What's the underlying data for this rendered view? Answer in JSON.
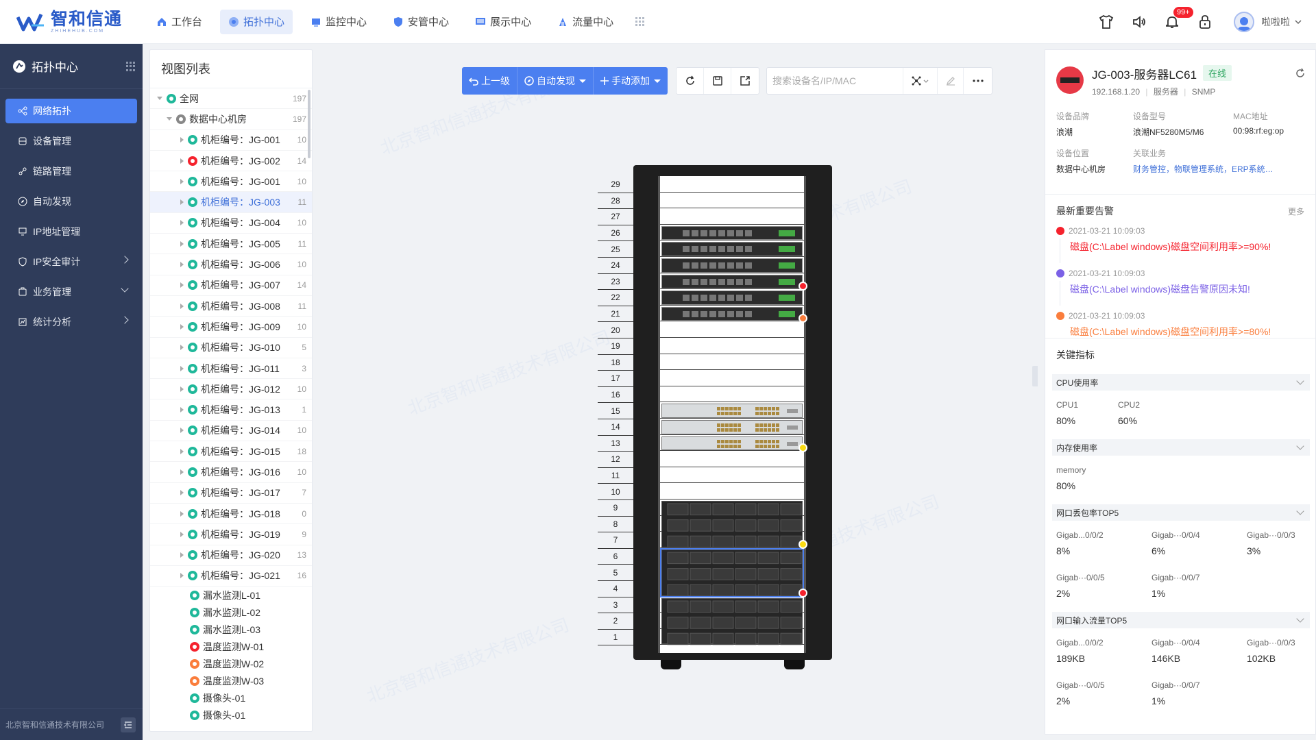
{
  "app": {
    "logo_title": "智和信通",
    "logo_sub": "ZHIHEHUB.COM"
  },
  "nav": [
    {
      "label": "工作台",
      "icon": "home-icon",
      "active": false
    },
    {
      "label": "拓扑中心",
      "icon": "topology-icon",
      "active": true
    },
    {
      "label": "监控中心",
      "icon": "monitor-icon",
      "active": false
    },
    {
      "label": "安管中心",
      "icon": "shield-icon",
      "active": false
    },
    {
      "label": "展示中心",
      "icon": "display-icon",
      "active": false
    },
    {
      "label": "流量中心",
      "icon": "traffic-icon",
      "active": false
    }
  ],
  "top_right": {
    "notification_count": "99+",
    "username": "啦啦啦"
  },
  "sidebar": {
    "title": "拓扑中心",
    "items": [
      {
        "label": "网络拓扑",
        "active": true,
        "arrow": ""
      },
      {
        "label": "设备管理",
        "active": false,
        "arrow": ""
      },
      {
        "label": "链路管理",
        "active": false,
        "arrow": ""
      },
      {
        "label": "自动发现",
        "active": false,
        "arrow": ""
      },
      {
        "label": "IP地址管理",
        "active": false,
        "arrow": ""
      },
      {
        "label": "IP安全审计",
        "active": false,
        "arrow": "right"
      },
      {
        "label": "业务管理",
        "active": false,
        "arrow": "down"
      },
      {
        "label": "统计分析",
        "active": false,
        "arrow": "right"
      }
    ],
    "footer": "北京智和信通技术有限公司"
  },
  "tree": {
    "title": "视图列表",
    "root": {
      "label": "全网",
      "count": "197"
    },
    "datacenter": {
      "label": "数据中心机房",
      "count": "197"
    },
    "cabinets": [
      {
        "label": "机柜编号：JG-001",
        "count": "10",
        "status": "ok",
        "selected": false
      },
      {
        "label": "机柜编号：JG-002",
        "count": "14",
        "status": "error",
        "selected": false
      },
      {
        "label": "机柜编号：JG-001",
        "count": "10",
        "status": "ok",
        "selected": false
      },
      {
        "label": "机柜编号：JG-003",
        "count": "11",
        "status": "ok",
        "selected": true
      },
      {
        "label": "机柜编号：JG-004",
        "count": "10",
        "status": "ok",
        "selected": false
      },
      {
        "label": "机柜编号：JG-005",
        "count": "11",
        "status": "ok",
        "selected": false
      },
      {
        "label": "机柜编号：JG-006",
        "count": "10",
        "status": "ok",
        "selected": false
      },
      {
        "label": "机柜编号：JG-007",
        "count": "14",
        "status": "ok",
        "selected": false
      },
      {
        "label": "机柜编号：JG-008",
        "count": "11",
        "status": "ok",
        "selected": false
      },
      {
        "label": "机柜编号：JG-009",
        "count": "10",
        "status": "ok",
        "selected": false
      },
      {
        "label": "机柜编号：JG-010",
        "count": "5",
        "status": "ok",
        "selected": false
      },
      {
        "label": "机柜编号：JG-011",
        "count": "3",
        "status": "ok",
        "selected": false
      },
      {
        "label": "机柜编号：JG-012",
        "count": "10",
        "status": "ok",
        "selected": false
      },
      {
        "label": "机柜编号：JG-013",
        "count": "1",
        "status": "ok",
        "selected": false
      },
      {
        "label": "机柜编号：JG-014",
        "count": "10",
        "status": "ok",
        "selected": false
      },
      {
        "label": "机柜编号：JG-015",
        "count": "18",
        "status": "ok",
        "selected": false
      },
      {
        "label": "机柜编号：JG-016",
        "count": "10",
        "status": "ok",
        "selected": false
      },
      {
        "label": "机柜编号：JG-017",
        "count": "7",
        "status": "ok",
        "selected": false
      },
      {
        "label": "机柜编号：JG-018",
        "count": "0",
        "status": "ok",
        "selected": false
      },
      {
        "label": "机柜编号：JG-019",
        "count": "9",
        "status": "ok",
        "selected": false
      },
      {
        "label": "机柜编号：JG-020",
        "count": "13",
        "status": "ok",
        "selected": false
      },
      {
        "label": "机柜编号：JG-021",
        "count": "16",
        "status": "ok",
        "selected": false
      }
    ],
    "sensors": [
      {
        "label": "漏水监测L-01",
        "status": "water"
      },
      {
        "label": "漏水监测L-02",
        "status": "water"
      },
      {
        "label": "漏水监测L-03",
        "status": "water"
      },
      {
        "label": "温度监测W-01",
        "status": "temp-red"
      },
      {
        "label": "温度监测W-02",
        "status": "temp-orange"
      },
      {
        "label": "温度监测W-03",
        "status": "temp-orange"
      },
      {
        "label": "摄像头-01",
        "status": "camera"
      },
      {
        "label": "摄像头-01",
        "status": "camera"
      }
    ]
  },
  "toolbar": {
    "up_label": "上一级",
    "discover_label": "自动发现",
    "add_label": "手动添加",
    "search_placeholder": "搜索设备名/IP/MAC"
  },
  "rack": {
    "units": [
      "29",
      "28",
      "27",
      "26",
      "25",
      "24",
      "23",
      "22",
      "21",
      "20",
      "19",
      "18",
      "17",
      "16",
      "15",
      "14",
      "13",
      "12",
      "11",
      "10",
      "9",
      "8",
      "7",
      "6",
      "5",
      "4",
      "3",
      "2",
      "1"
    ],
    "watermark": "北京智和信通技术有限公司"
  },
  "device": {
    "name": "JG-003-服务器LC61",
    "status": "在线",
    "ip": "192.168.1.20",
    "type": "服务器",
    "protocol": "SNMP",
    "brand_k": "设备品牌",
    "brand_v": "浪潮",
    "model_k": "设备型号",
    "model_v": "浪潮NF5280M5/M6",
    "mac_k": "MAC地址",
    "mac_v": "00:98:rf:eg:op",
    "loc_k": "设备位置",
    "loc_v": "数据中心机房",
    "biz_k": "关联业务",
    "biz_v": "财务管控，物联管理系统，ERP系统…"
  },
  "alarms": {
    "title": "最新重要告警",
    "more": "更多",
    "items": [
      {
        "time": "2021-03-21 10:09:03",
        "text": "磁盘(C:\\Label windows)磁盘空间利用率>=90%!",
        "color": "#f5222d"
      },
      {
        "time": "2021-03-21 10:09:03",
        "text": "磁盘(C:\\Label windows)磁盘告警原因未知!",
        "color": "#7b61e6"
      },
      {
        "time": "2021-03-21 10:09:03",
        "text": "磁盘(C:\\Label windows)磁盘空间利用率>=80%!",
        "color": "#fa7d3c"
      }
    ]
  },
  "kpi": {
    "title": "关键指标",
    "cpu_title": "CPU使用率",
    "cpu": [
      {
        "k": "CPU1",
        "v": "80%"
      },
      {
        "k": "CPU2",
        "v": "60%"
      }
    ],
    "mem_title": "内存使用率",
    "mem": [
      {
        "k": "memory",
        "v": "80%"
      }
    ],
    "loss_title": "网口丢包率TOP5",
    "loss": [
      {
        "k": "Gigab...0/0/2",
        "v": "8%"
      },
      {
        "k": "Gigab···0/0/4",
        "v": "6%"
      },
      {
        "k": "Gigab···0/0/3",
        "v": "3%"
      },
      {
        "k": "Gigab···0/0/5",
        "v": "2%"
      },
      {
        "k": "Gigab···0/0/7",
        "v": "1%"
      }
    ],
    "in_title": "网口输入流量TOP5",
    "in": [
      {
        "k": "Gigab...0/0/2",
        "v": "189KB"
      },
      {
        "k": "Gigab···0/0/4",
        "v": "146KB"
      },
      {
        "k": "Gigab···0/0/3",
        "v": "102KB"
      },
      {
        "k": "Gigab···0/0/5",
        "v": "2%"
      },
      {
        "k": "Gigab···0/0/7",
        "v": "1%"
      }
    ]
  }
}
